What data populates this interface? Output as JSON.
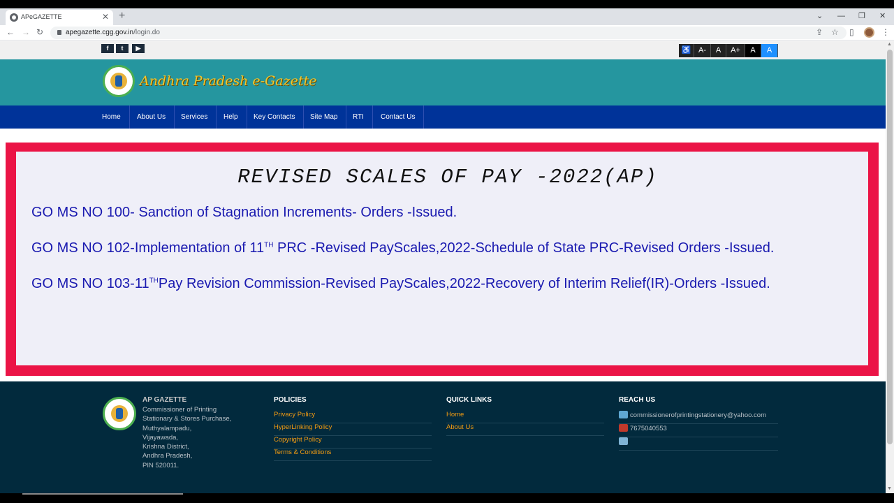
{
  "browser": {
    "tab_title": "APeGAZETTE",
    "tab_close": "✕",
    "new_tab": "+",
    "window_controls": [
      "⌄",
      "—",
      "❐",
      "✕"
    ],
    "nav_back": "←",
    "nav_forward": "→",
    "nav_reload": "↻",
    "url_host": "apegazette.cgg.gov.in",
    "url_path": "/login.do",
    "toolbar_icons": [
      "share-icon",
      "star-icon",
      "sidebar-icon",
      "profile-avatar",
      "menu-icon"
    ],
    "toolbar_glyphs": [
      "⇪",
      "☆",
      "▯",
      "⋮"
    ]
  },
  "utility_bar": {
    "social": [
      {
        "icon": "facebook-icon",
        "label": "f"
      },
      {
        "icon": "twitter-icon",
        "label": "t"
      },
      {
        "icon": "youtube-icon",
        "label": "▶"
      }
    ],
    "font_controls": [
      "♿",
      "A-",
      "A",
      "A+",
      "A",
      "A"
    ]
  },
  "header": {
    "brand": "Andhra Pradesh e-Gazette"
  },
  "nav": {
    "items": [
      "Home",
      "About Us",
      "Services",
      "Help",
      "Key Contacts",
      "Site Map",
      "RTI",
      "Contact Us"
    ]
  },
  "main": {
    "heading": "REVISED SCALES OF PAY -2022(AP)",
    "links": [
      {
        "text": "GO MS NO 100- Sanction of Stagnation Increments- Orders -Issued."
      },
      {
        "pre": "GO MS NO 102-Implementation of 11",
        "sup": "TH",
        "post": " PRC -Revised PayScales,2022-Schedule of State PRC-Revised Orders -Issued."
      },
      {
        "pre": "GO MS NO 103-11",
        "sup": "TH",
        "post": "Pay Revision Commission-Revised PayScales,2022-Recovery of Interim Relief(IR)-Orders -Issued."
      }
    ]
  },
  "footer": {
    "about": {
      "title": "AP GAZETTE",
      "address_lines": [
        "Commissioner of Printing",
        "Stationary & Stores Purchase,",
        "Muthyalampadu,",
        "Vijayawada,",
        "Krishna District,",
        "Andhra Pradesh,",
        "PIN 520011."
      ]
    },
    "policies": {
      "title": "POLICIES",
      "links": [
        "Privacy Policy",
        "HyperLinking Policy",
        "Copyright Policy",
        "Terms & Conditions"
      ]
    },
    "quick_links": {
      "title": "QUICK LINKS",
      "links": [
        "Home",
        "About Us"
      ]
    },
    "reach_us": {
      "title": "REACH US",
      "email": "commissionerofprintingstationery@yahoo.com",
      "phone": "7675040553",
      "fax": ""
    }
  },
  "colors": {
    "header_teal": "#25969f",
    "nav_blue": "#003399",
    "content_border": "#eb1446",
    "link_blue": "#1a1ab0",
    "footer_bg": "#022a3d",
    "footer_link": "#f39c12"
  }
}
